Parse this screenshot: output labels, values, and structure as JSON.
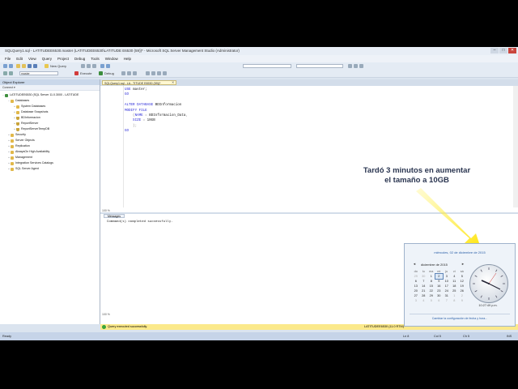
{
  "window": {
    "title": "SQLQuery1.sql - LATITUDEE6530.master (LATITUDEE6530\\LATITUDE E6530 (59))* - Microsoft SQL Server Management Studio (Administrator)",
    "controls": [
      "–",
      "□",
      "✕"
    ]
  },
  "menu": [
    "File",
    "Edit",
    "View",
    "Query",
    "Project",
    "Debug",
    "Tools",
    "Window",
    "Help"
  ],
  "toolbar": {
    "new_query_label": "New Query",
    "database_combo": "master",
    "execute_label": "Execute",
    "debug_label": "Debug"
  },
  "object_explorer": {
    "header": "Object Explorer",
    "connect_label": "Connect ▾",
    "nodes": [
      {
        "label": "LATITUDEE6530 (SQL Server 11.0.3000 - LATITUDE",
        "level": 0,
        "icon": "server-icon",
        "expander": "−"
      },
      {
        "label": "Databases",
        "level": 1,
        "icon": "folder-icon",
        "expander": "−"
      },
      {
        "label": "System Databases",
        "level": 2,
        "icon": "folder-icon",
        "expander": "+"
      },
      {
        "label": "Database Snapshots",
        "level": 2,
        "icon": "folder-icon",
        "expander": "+"
      },
      {
        "label": "BDInformacion",
        "level": 2,
        "icon": "database-icon",
        "expander": "+"
      },
      {
        "label": "ReportServer",
        "level": 2,
        "icon": "database-icon",
        "expander": "+"
      },
      {
        "label": "ReportServerTempDB",
        "level": 2,
        "icon": "database-icon",
        "expander": "+"
      },
      {
        "label": "Security",
        "level": 1,
        "icon": "folder-icon",
        "expander": "+"
      },
      {
        "label": "Server Objects",
        "level": 1,
        "icon": "folder-icon",
        "expander": "+"
      },
      {
        "label": "Replication",
        "level": 1,
        "icon": "folder-icon",
        "expander": "+"
      },
      {
        "label": "AlwaysOn High Availability",
        "level": 1,
        "icon": "folder-icon",
        "expander": "+"
      },
      {
        "label": "Management",
        "level": 1,
        "icon": "folder-icon",
        "expander": "+"
      },
      {
        "label": "Integration Services Catalogs",
        "level": 1,
        "icon": "folder-icon",
        "expander": "+"
      },
      {
        "label": "SQL Server Agent",
        "level": 1,
        "icon": "agent-icon",
        "expander": "+"
      }
    ]
  },
  "editor": {
    "tab_label": "SQLQuery1.sql - LA...TITUDE E6530 (59))*",
    "tab_close": "✕",
    "code": [
      [
        {
          "c": "kw",
          "t": "USE "
        },
        {
          "c": "id",
          "t": "master;"
        }
      ],
      [
        {
          "c": "kw",
          "t": "GO"
        }
      ],
      [],
      [
        {
          "c": "kw",
          "t": "ALTER DATABASE "
        },
        {
          "c": "id",
          "t": "BDInformacion"
        }
      ],
      [
        {
          "c": "kw",
          "t": "MODIFY FILE"
        }
      ],
      [
        {
          "c": "gry",
          "t": "    ("
        },
        {
          "c": "kw",
          "t": "NAME "
        },
        {
          "c": "gry",
          "t": "= "
        },
        {
          "c": "id",
          "t": "BDInformacion_Data"
        },
        {
          "c": "gry",
          "t": ","
        }
      ],
      [
        {
          "c": "kw",
          "t": "    SIZE "
        },
        {
          "c": "gry",
          "t": "= "
        },
        {
          "c": "id",
          "t": "10GB"
        }
      ],
      [
        {
          "c": "gry",
          "t": "    );"
        }
      ],
      [
        {
          "c": "kw",
          "t": "GO"
        }
      ]
    ],
    "zoom": "100 %",
    "messages_tab": "Messages",
    "message": "Command(s) completed successfully.",
    "zoom_bottom": "100 %"
  },
  "status": {
    "query_status": "Query executed successfully.",
    "server": "LATITUDEE6530 (11.0 RTM)"
  },
  "bottom_status": {
    "left": "Ready",
    "ln": "Ln 8",
    "col": "Col 5",
    "ch": "Ch 5",
    "mode": "INS"
  },
  "annotation": {
    "line1": "Tardó 3 minutos en aumentar",
    "line2": "el tamaño a 10GB"
  },
  "calendar": {
    "full_date": "miércoles, 02 de diciembre de 2015",
    "month_label": "diciembre de 2015",
    "days_header": [
      "do",
      "lu",
      "ma",
      "mi",
      "ju",
      "vi",
      "sá"
    ],
    "weeks": [
      [
        "29",
        "30",
        "1",
        "2",
        "3",
        "4",
        "5"
      ],
      [
        "6",
        "7",
        "8",
        "9",
        "10",
        "11",
        "12"
      ],
      [
        "13",
        "14",
        "15",
        "16",
        "17",
        "18",
        "19"
      ],
      [
        "20",
        "21",
        "22",
        "23",
        "24",
        "25",
        "26"
      ],
      [
        "27",
        "28",
        "29",
        "30",
        "31",
        "1",
        "2"
      ],
      [
        "3",
        "4",
        "5",
        "6",
        "7",
        "8",
        "9"
      ]
    ],
    "today": "2",
    "time": "10:27:49 p.m.",
    "settings_link": "Cambiar la configuración de fecha y hora...",
    "nav_prev": "◄",
    "nav_next": "►"
  }
}
